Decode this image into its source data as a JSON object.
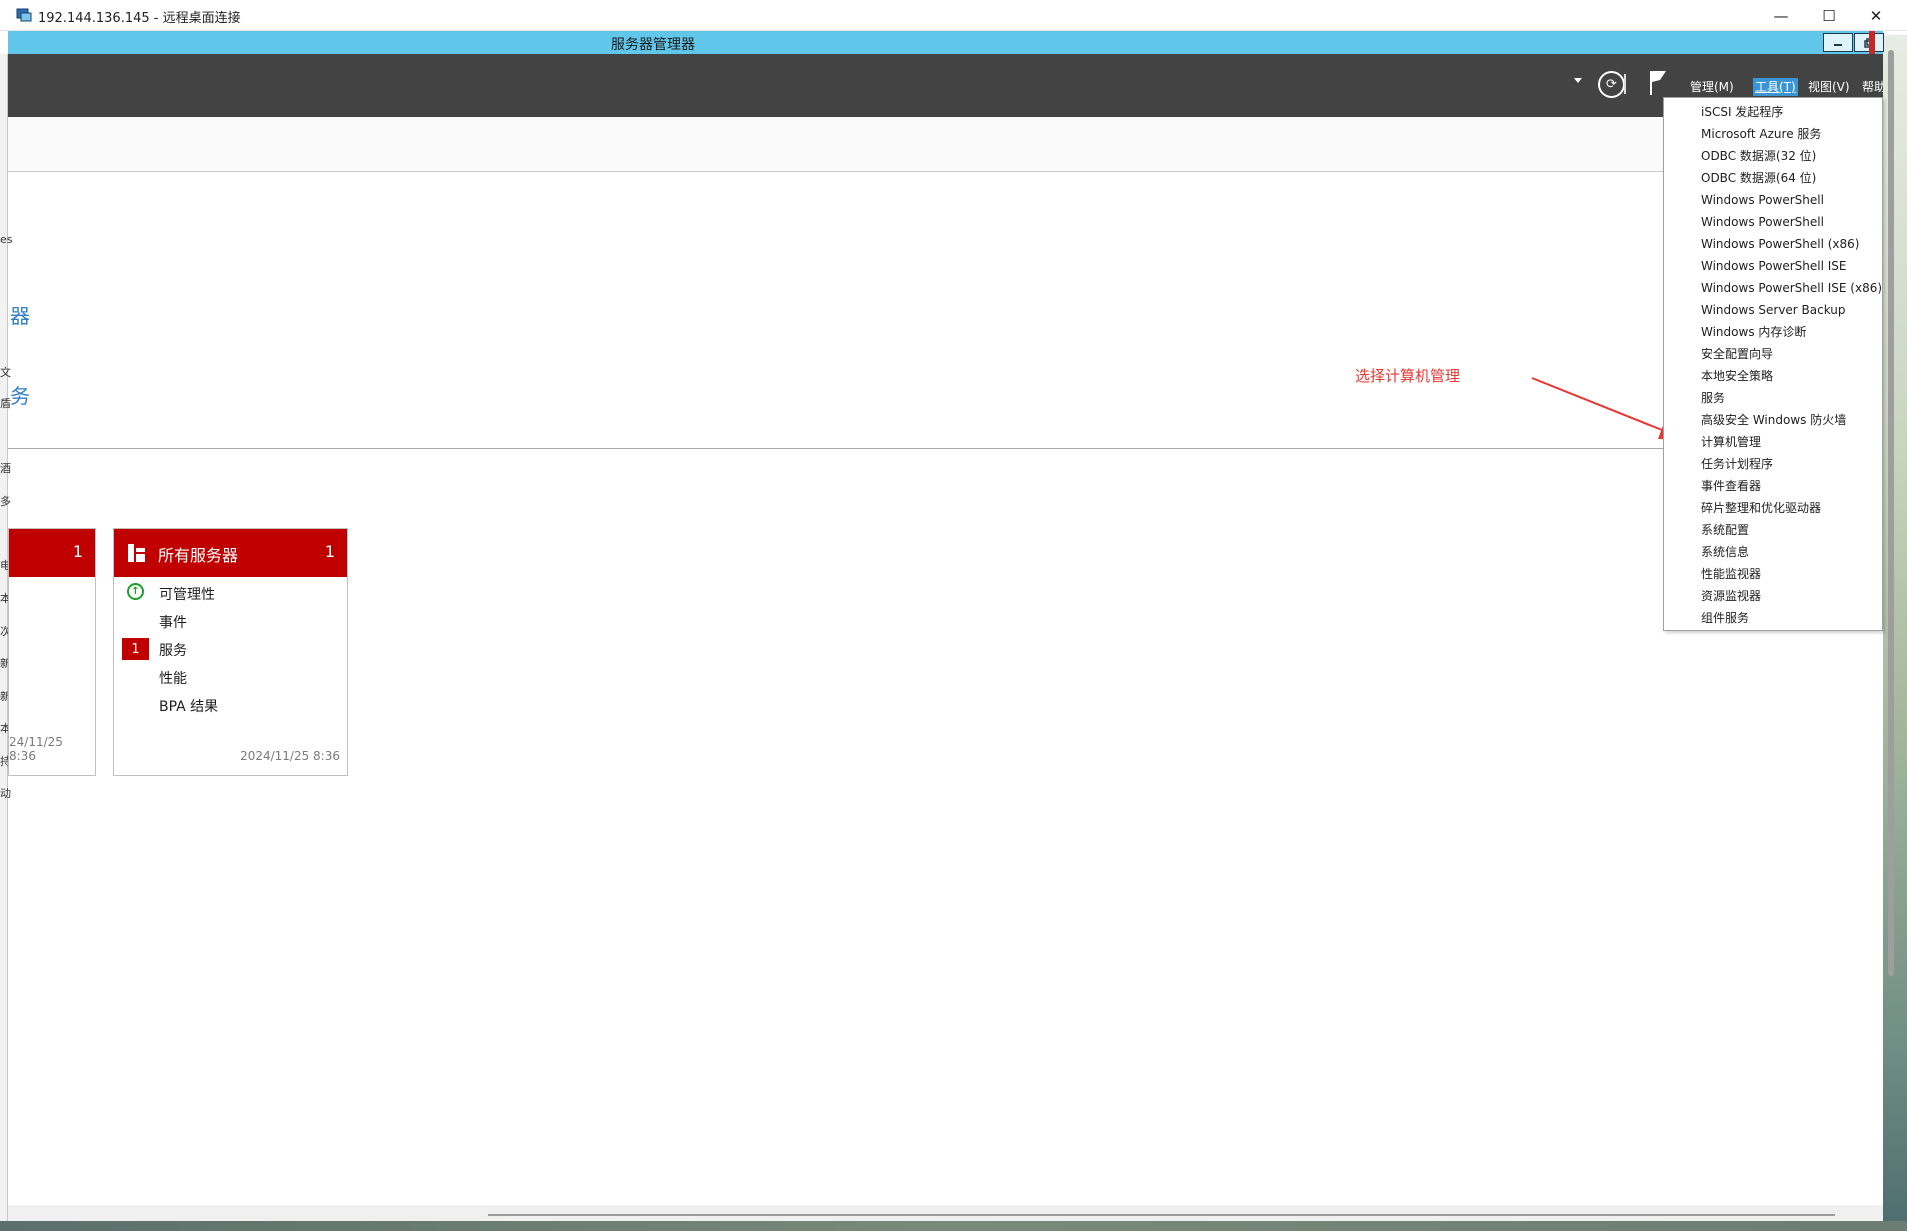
{
  "rdp": {
    "title": "192.144.136.145 - 远程桌面连接",
    "minimize": "—",
    "maximize": "☐",
    "close": "✕"
  },
  "server_manager": {
    "title": "服务器管理器"
  },
  "header": {
    "refresh_glyph": "⟳",
    "menus": [
      "管理(M)",
      "工具(T)",
      "视图(V)",
      "帮助"
    ]
  },
  "hero_fragments": [
    "器",
    "务"
  ],
  "left_fragments": [
    "es",
    "文",
    "盾",
    "酒",
    "多",
    "电",
    "本",
    "次",
    "新",
    "新",
    "本",
    "持",
    "动"
  ],
  "annotation": "选择计算机管理",
  "tiles": [
    {
      "title": "",
      "count": "1",
      "timestamp": "24/11/25 8:36"
    },
    {
      "title": "所有服务器",
      "count": "1",
      "rows": [
        {
          "label": "可管理性",
          "status": "ok"
        },
        {
          "label": "事件"
        },
        {
          "label": "服务",
          "badge": "1"
        },
        {
          "label": "性能"
        },
        {
          "label": "BPA 结果"
        }
      ],
      "timestamp": "2024/11/25 8:36"
    }
  ],
  "tools_menu": [
    "iSCSI 发起程序",
    "Microsoft Azure 服务",
    "ODBC 数据源(32 位)",
    "ODBC 数据源(64 位)",
    "Windows PowerShell",
    "Windows PowerShell",
    "Windows PowerShell (x86)",
    "Windows PowerShell ISE",
    "Windows PowerShell ISE (x86)",
    "Windows Server Backup",
    "Windows 内存诊断",
    "安全配置向导",
    "本地安全策略",
    "服务",
    "高级安全 Windows 防火墙",
    "计算机管理",
    "任务计划程序",
    "事件查看器",
    "碎片整理和优化驱动器",
    "系统配置",
    "系统信息",
    "性能监视器",
    "资源监视器",
    "组件服务"
  ],
  "colors": {
    "title_bar": "#61c7ea",
    "header": "#434343",
    "tile_red": "#c00000",
    "menu_active": "#3a95d4",
    "annotation": "#e53935"
  }
}
